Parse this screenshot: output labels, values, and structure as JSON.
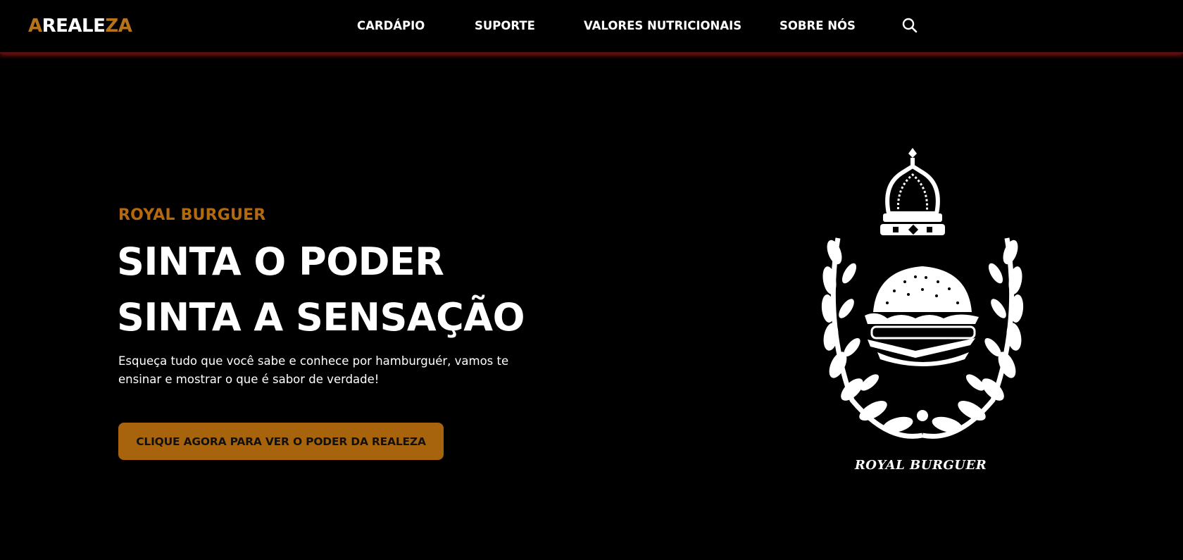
{
  "brand": {
    "parts": [
      {
        "text": "A",
        "accent": true
      },
      {
        "text": "REALE",
        "accent": false
      },
      {
        "text": "ZA",
        "accent": true
      }
    ],
    "accent_color": "#b5741a"
  },
  "nav": {
    "items": [
      {
        "label": "CARDÁPIO"
      },
      {
        "label": "SUPORTE"
      },
      {
        "label": "VALORES NUTRICIONAIS"
      },
      {
        "label": "SOBRE NÓS"
      }
    ],
    "search_icon": "search-icon"
  },
  "hero": {
    "eyebrow": "ROYAL BURGUER",
    "headline_line1": "SINTA O PODER",
    "headline_line2": "SINTA A SENSAÇÃO",
    "description": "Esqueça tudo que você sabe e conhece por hamburguér, vamos te ensinar e mostrar o que é sabor de verdade!",
    "cta_label": "CLIQUE AGORA PARA VER O PODER DA REALEZA",
    "cta_color": "#a8640c",
    "eyebrow_color": "#b5690f"
  },
  "emblem": {
    "caption": "ROYAL BURGUER",
    "icon": "crown-burger-laurel-emblem"
  },
  "theme": {
    "background": "#000000",
    "navbar_glow": "#8c1414"
  }
}
